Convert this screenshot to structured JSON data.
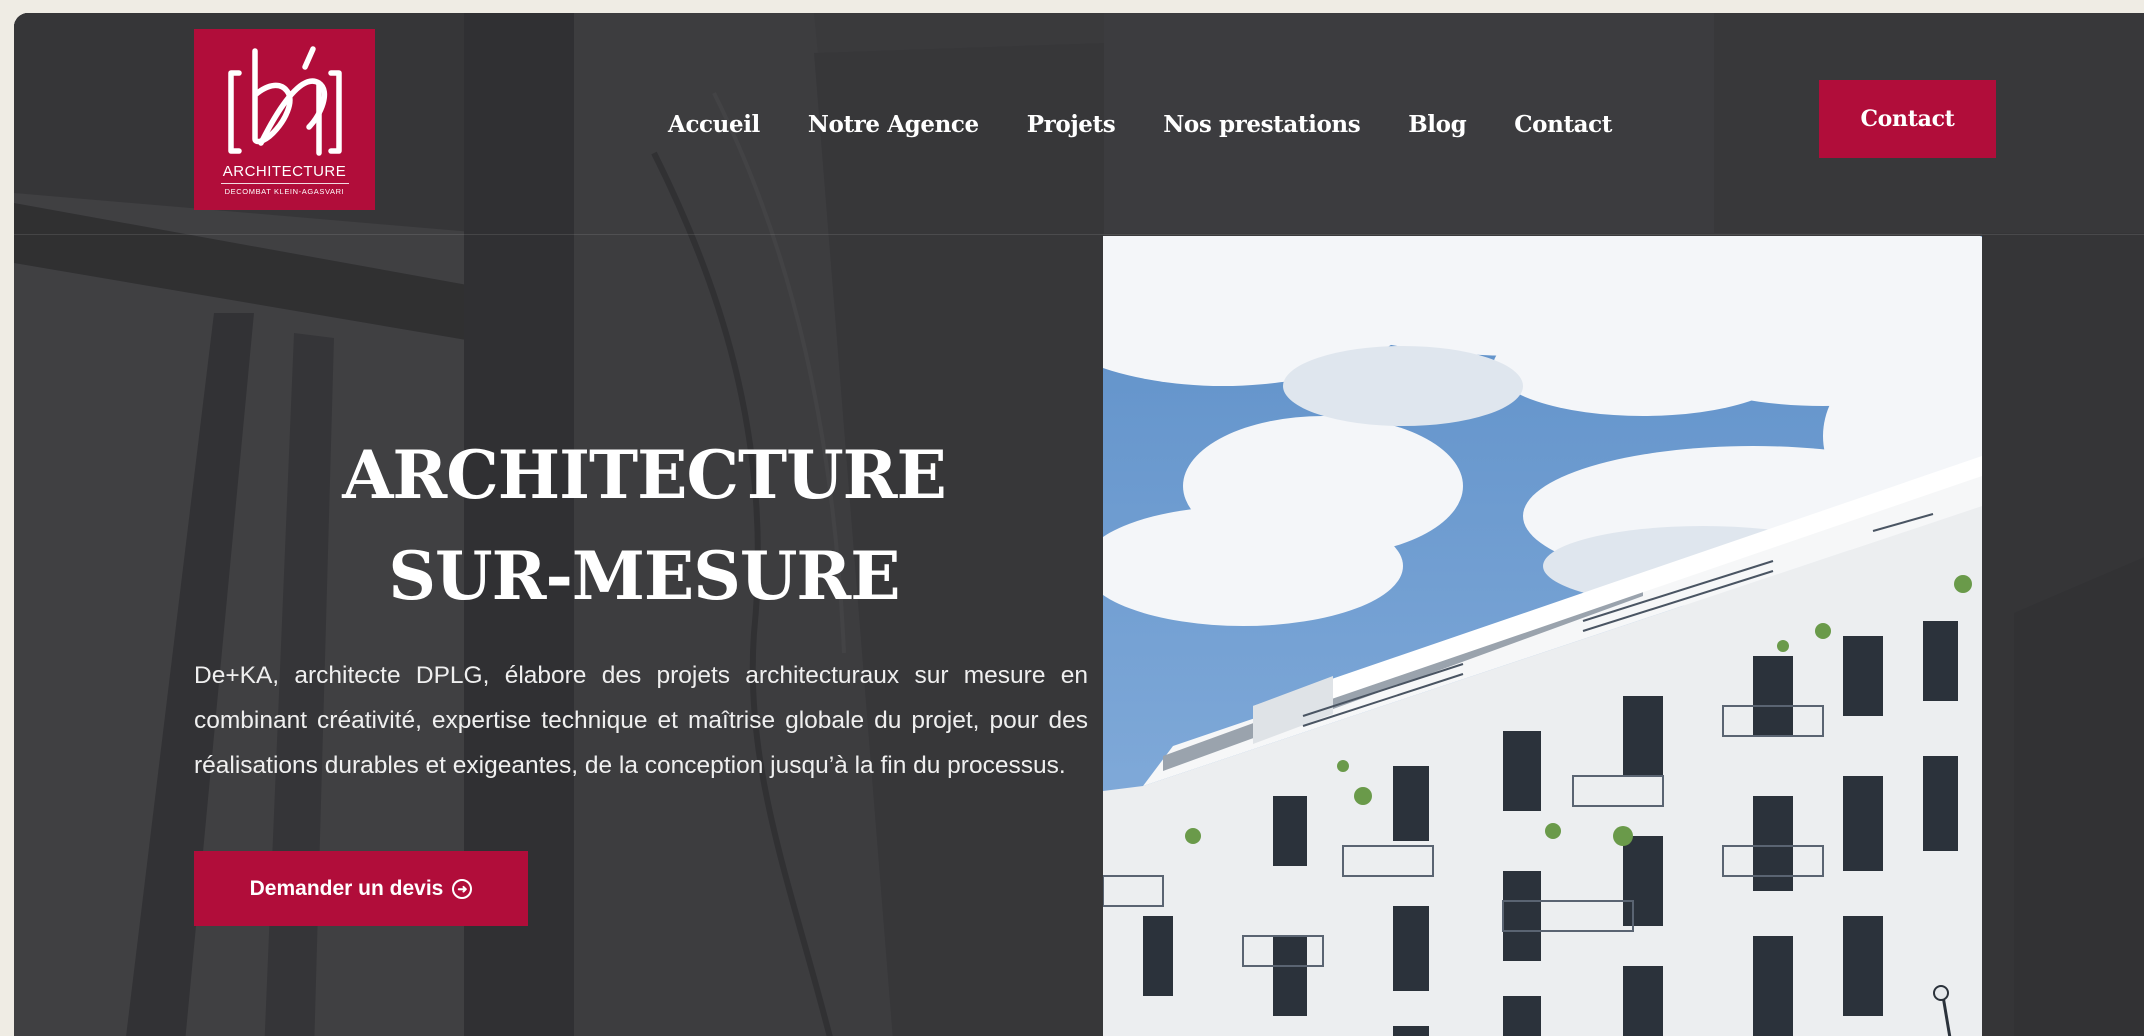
{
  "logo": {
    "wordmark": "ARCHITECTURE",
    "tagline": "DECOMBAT KLEIN-AGASVARI"
  },
  "nav": {
    "items": [
      {
        "label": "Accueil"
      },
      {
        "label": "Notre Agence"
      },
      {
        "label": "Projets"
      },
      {
        "label": "Nos prestations"
      },
      {
        "label": "Blog"
      },
      {
        "label": "Contact"
      }
    ]
  },
  "header": {
    "contact_button": "Contact"
  },
  "hero": {
    "title_line1": "ARCHITECTURE",
    "title_line2": "SUR-MESURE",
    "description": "De+KA, architecte DPLG, élabore des projets architecturaux sur mesure en combinant créativité, expertise technique et maîtrise globale du projet, pour des réalisations durables et exigeantes, de la conception jusqu’à la fin du processus.",
    "cta_label": "Demander un devis"
  },
  "icons": {
    "cta_icon": "arrow-right-circle-icon"
  },
  "colors": {
    "brand": "#b10d3a",
    "background": "#3d3d3f",
    "page": "#efece4"
  }
}
